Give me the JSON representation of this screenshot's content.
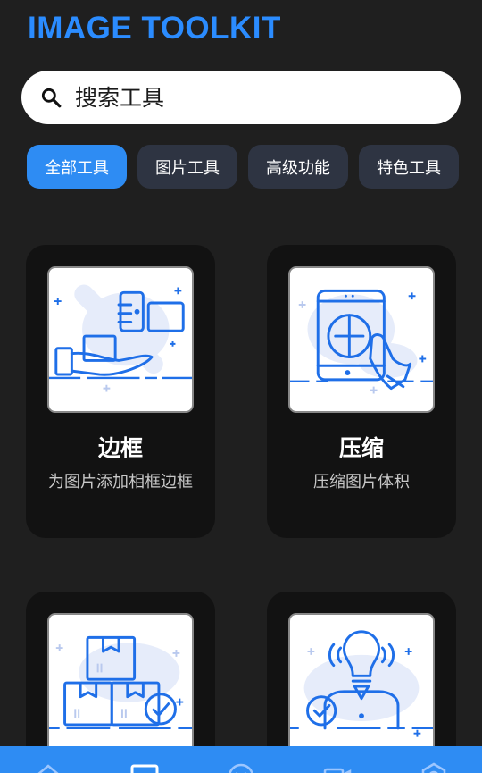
{
  "app": {
    "title": "IMAGE TOOLKIT"
  },
  "search": {
    "placeholder": "搜索工具"
  },
  "chips": [
    {
      "label": "全部工具",
      "active": true
    },
    {
      "label": "图片工具",
      "active": false
    },
    {
      "label": "高级功能",
      "active": false
    },
    {
      "label": "特色工具",
      "active": false
    }
  ],
  "tools": [
    {
      "name": "边框",
      "desc": "为图片添加相框边框",
      "icon": "hand-giving-box-icon"
    },
    {
      "name": "压缩",
      "desc": "压缩图片体积",
      "icon": "tablet-touch-icon"
    },
    {
      "name": "",
      "desc": "",
      "icon": "stacked-boxes-check-icon"
    },
    {
      "name": "",
      "desc": "",
      "icon": "lightbulb-person-icon"
    }
  ],
  "colors": {
    "accent": "#2e8cf3",
    "background": "#1f1f1f",
    "card": "#121212",
    "chip": "#2e3442",
    "title": "#2b8cff"
  },
  "bottom_nav": [
    "home-icon",
    "image-icon",
    "smile-icon",
    "video-icon",
    "settings-icon"
  ]
}
